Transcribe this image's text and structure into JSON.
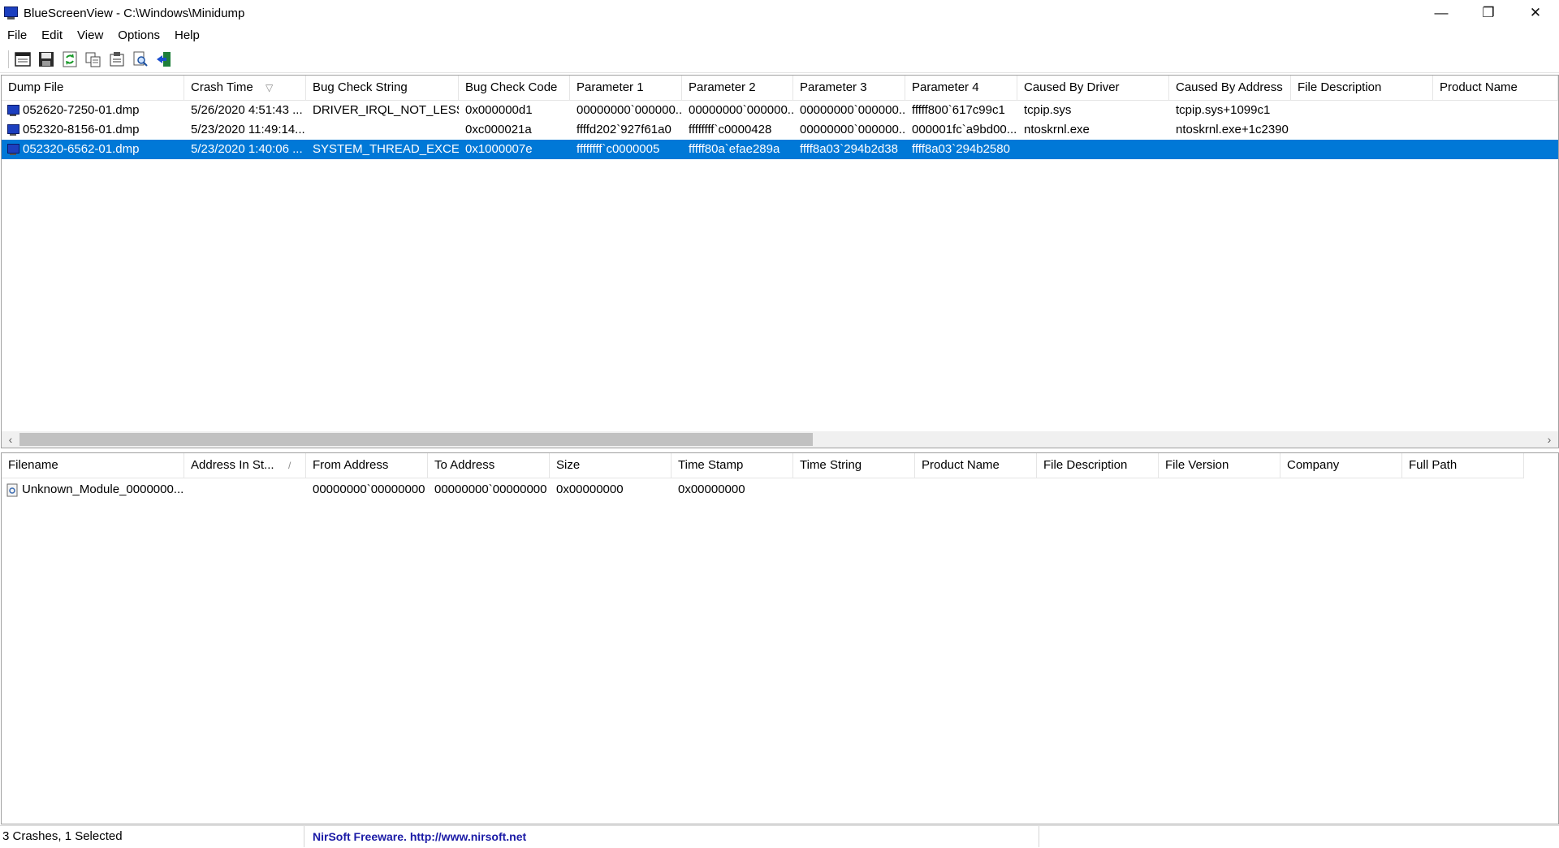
{
  "window": {
    "title": "BlueScreenView  -  C:\\Windows\\Minidump",
    "controls": {
      "minimize": "—",
      "restore": "❐",
      "close": "✕"
    }
  },
  "menu": [
    "File",
    "Edit",
    "View",
    "Options",
    "Help"
  ],
  "toolbar": {
    "buttons": [
      "html-report-icon",
      "save-icon",
      "refresh-icon",
      "copy-icon",
      "properties-icon",
      "find-icon",
      "exit-icon"
    ]
  },
  "crash_list": {
    "columns": [
      "Dump File",
      "Crash Time",
      "Bug Check String",
      "Bug Check Code",
      "Parameter 1",
      "Parameter 2",
      "Parameter 3",
      "Parameter 4",
      "Caused By Driver",
      "Caused By Address",
      "File Description",
      "Product Name"
    ],
    "sort_indicator": "▽",
    "rows": [
      [
        "052620-7250-01.dmp",
        "5/26/2020 4:51:43 ...",
        "DRIVER_IRQL_NOT_LESS...",
        "0x000000d1",
        "00000000`000000...",
        "00000000`000000...",
        "00000000`000000...",
        "fffff800`617c99c1",
        "tcpip.sys",
        "tcpip.sys+1099c1",
        "",
        ""
      ],
      [
        "052320-8156-01.dmp",
        "5/23/2020 11:49:14...",
        "",
        "0xc000021a",
        "ffffd202`927f61a0",
        "ffffffff`c0000428",
        "00000000`000000...",
        "000001fc`a9bd00...",
        "ntoskrnl.exe",
        "ntoskrnl.exe+1c2390",
        "",
        ""
      ],
      [
        "052320-6562-01.dmp",
        "5/23/2020 1:40:06 ...",
        "SYSTEM_THREAD_EXCE...",
        "0x1000007e",
        "ffffffff`c0000005",
        "fffff80a`efae289a",
        "ffff8a03`294b2d38",
        "ffff8a03`294b2580",
        "",
        "",
        "",
        ""
      ]
    ],
    "selected_row": 2
  },
  "module_list": {
    "columns": [
      "Filename",
      "Address In St...",
      "From Address",
      "To Address",
      "Size",
      "Time Stamp",
      "Time String",
      "Product Name",
      "File Description",
      "File Version",
      "Company",
      "Full Path"
    ],
    "sort_indicator": "/",
    "rows": [
      [
        "Unknown_Module_0000000...",
        "",
        "00000000`00000000",
        "00000000`00000000",
        "0x00000000",
        "0x00000000",
        "",
        "",
        "",
        "",
        "",
        ""
      ]
    ]
  },
  "statusbar": {
    "summary": "3 Crashes, 1 Selected",
    "credit": "NirSoft Freeware.  http://www.nirsoft.net"
  },
  "colors": {
    "selection": "#0078d7",
    "link": "#1a1aa6",
    "dump_icon": "#1c3fbf"
  }
}
